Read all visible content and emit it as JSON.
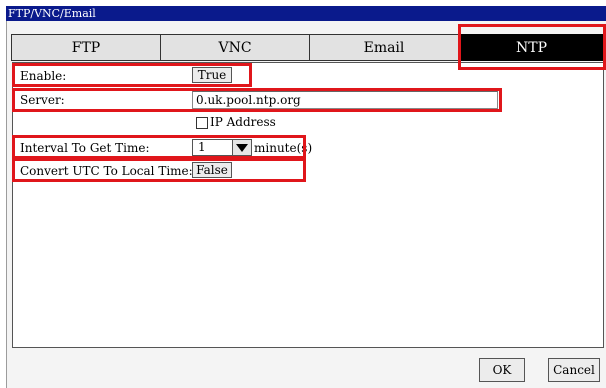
{
  "window": {
    "title": "FTP/VNC/Email"
  },
  "tabs": [
    {
      "label": "FTP",
      "active": false
    },
    {
      "label": "VNC",
      "active": false
    },
    {
      "label": "Email",
      "active": false
    },
    {
      "label": "NTP",
      "active": true
    }
  ],
  "ntp": {
    "enable": {
      "label": "Enable:",
      "value": "True"
    },
    "server": {
      "label": "Server:",
      "value": "0.uk.pool.ntp.org"
    },
    "ip_address": {
      "label": "IP Address",
      "checked": false
    },
    "interval": {
      "label": "Interval To Get Time:",
      "value": "1",
      "unit": "minute(s)"
    },
    "convert_utc": {
      "label": "Convert UTC To Local Time:",
      "value": "False"
    }
  },
  "footer": {
    "ok_label": "OK",
    "cancel_label": "Cancel"
  },
  "colors": {
    "titlebar": "#0a1a8c",
    "highlight": "#e0161b",
    "active_tab": "#000000"
  }
}
